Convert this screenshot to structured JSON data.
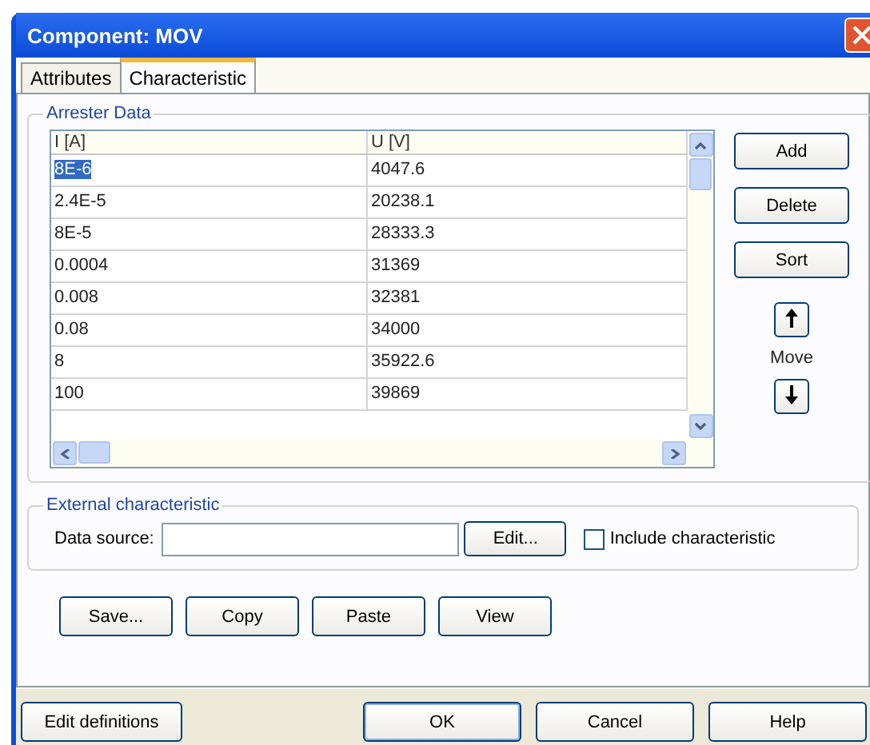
{
  "window": {
    "title": "Component: MOV"
  },
  "tabs": [
    {
      "label": "Attributes",
      "selected": false
    },
    {
      "label": "Characteristic",
      "selected": true
    }
  ],
  "arrester_data": {
    "legend": "Arrester Data",
    "columns": [
      "I [A]",
      "U [V]"
    ],
    "rows": [
      {
        "cells": [
          "8E-6",
          "4047.6"
        ],
        "selected": true
      },
      {
        "cells": [
          "2.4E-5",
          "20238.1"
        ],
        "selected": false
      },
      {
        "cells": [
          "8E-5",
          "28333.3"
        ],
        "selected": false
      },
      {
        "cells": [
          "0.0004",
          "31369"
        ],
        "selected": false
      },
      {
        "cells": [
          "0.008",
          "32381"
        ],
        "selected": false
      },
      {
        "cells": [
          "0.08",
          "34000"
        ],
        "selected": false
      },
      {
        "cells": [
          "8",
          "35922.6"
        ],
        "selected": false
      },
      {
        "cells": [
          "100",
          "39869"
        ],
        "selected": false
      }
    ],
    "buttons": [
      "Add",
      "Delete",
      "Sort"
    ],
    "move_label": "Move"
  },
  "external": {
    "legend": "External characteristic",
    "data_source_label": "Data source:",
    "edit_button": "Edit...",
    "include": {
      "label": "Include characteristic",
      "checked": false
    }
  },
  "action_buttons": [
    "Save...",
    "Copy",
    "Paste",
    "View"
  ],
  "footer_buttons": [
    {
      "label": "Edit definitions",
      "default": false
    },
    {
      "label": "OK",
      "default": true
    },
    {
      "label": "Cancel",
      "default": false
    },
    {
      "label": "Help",
      "default": false
    }
  ]
}
